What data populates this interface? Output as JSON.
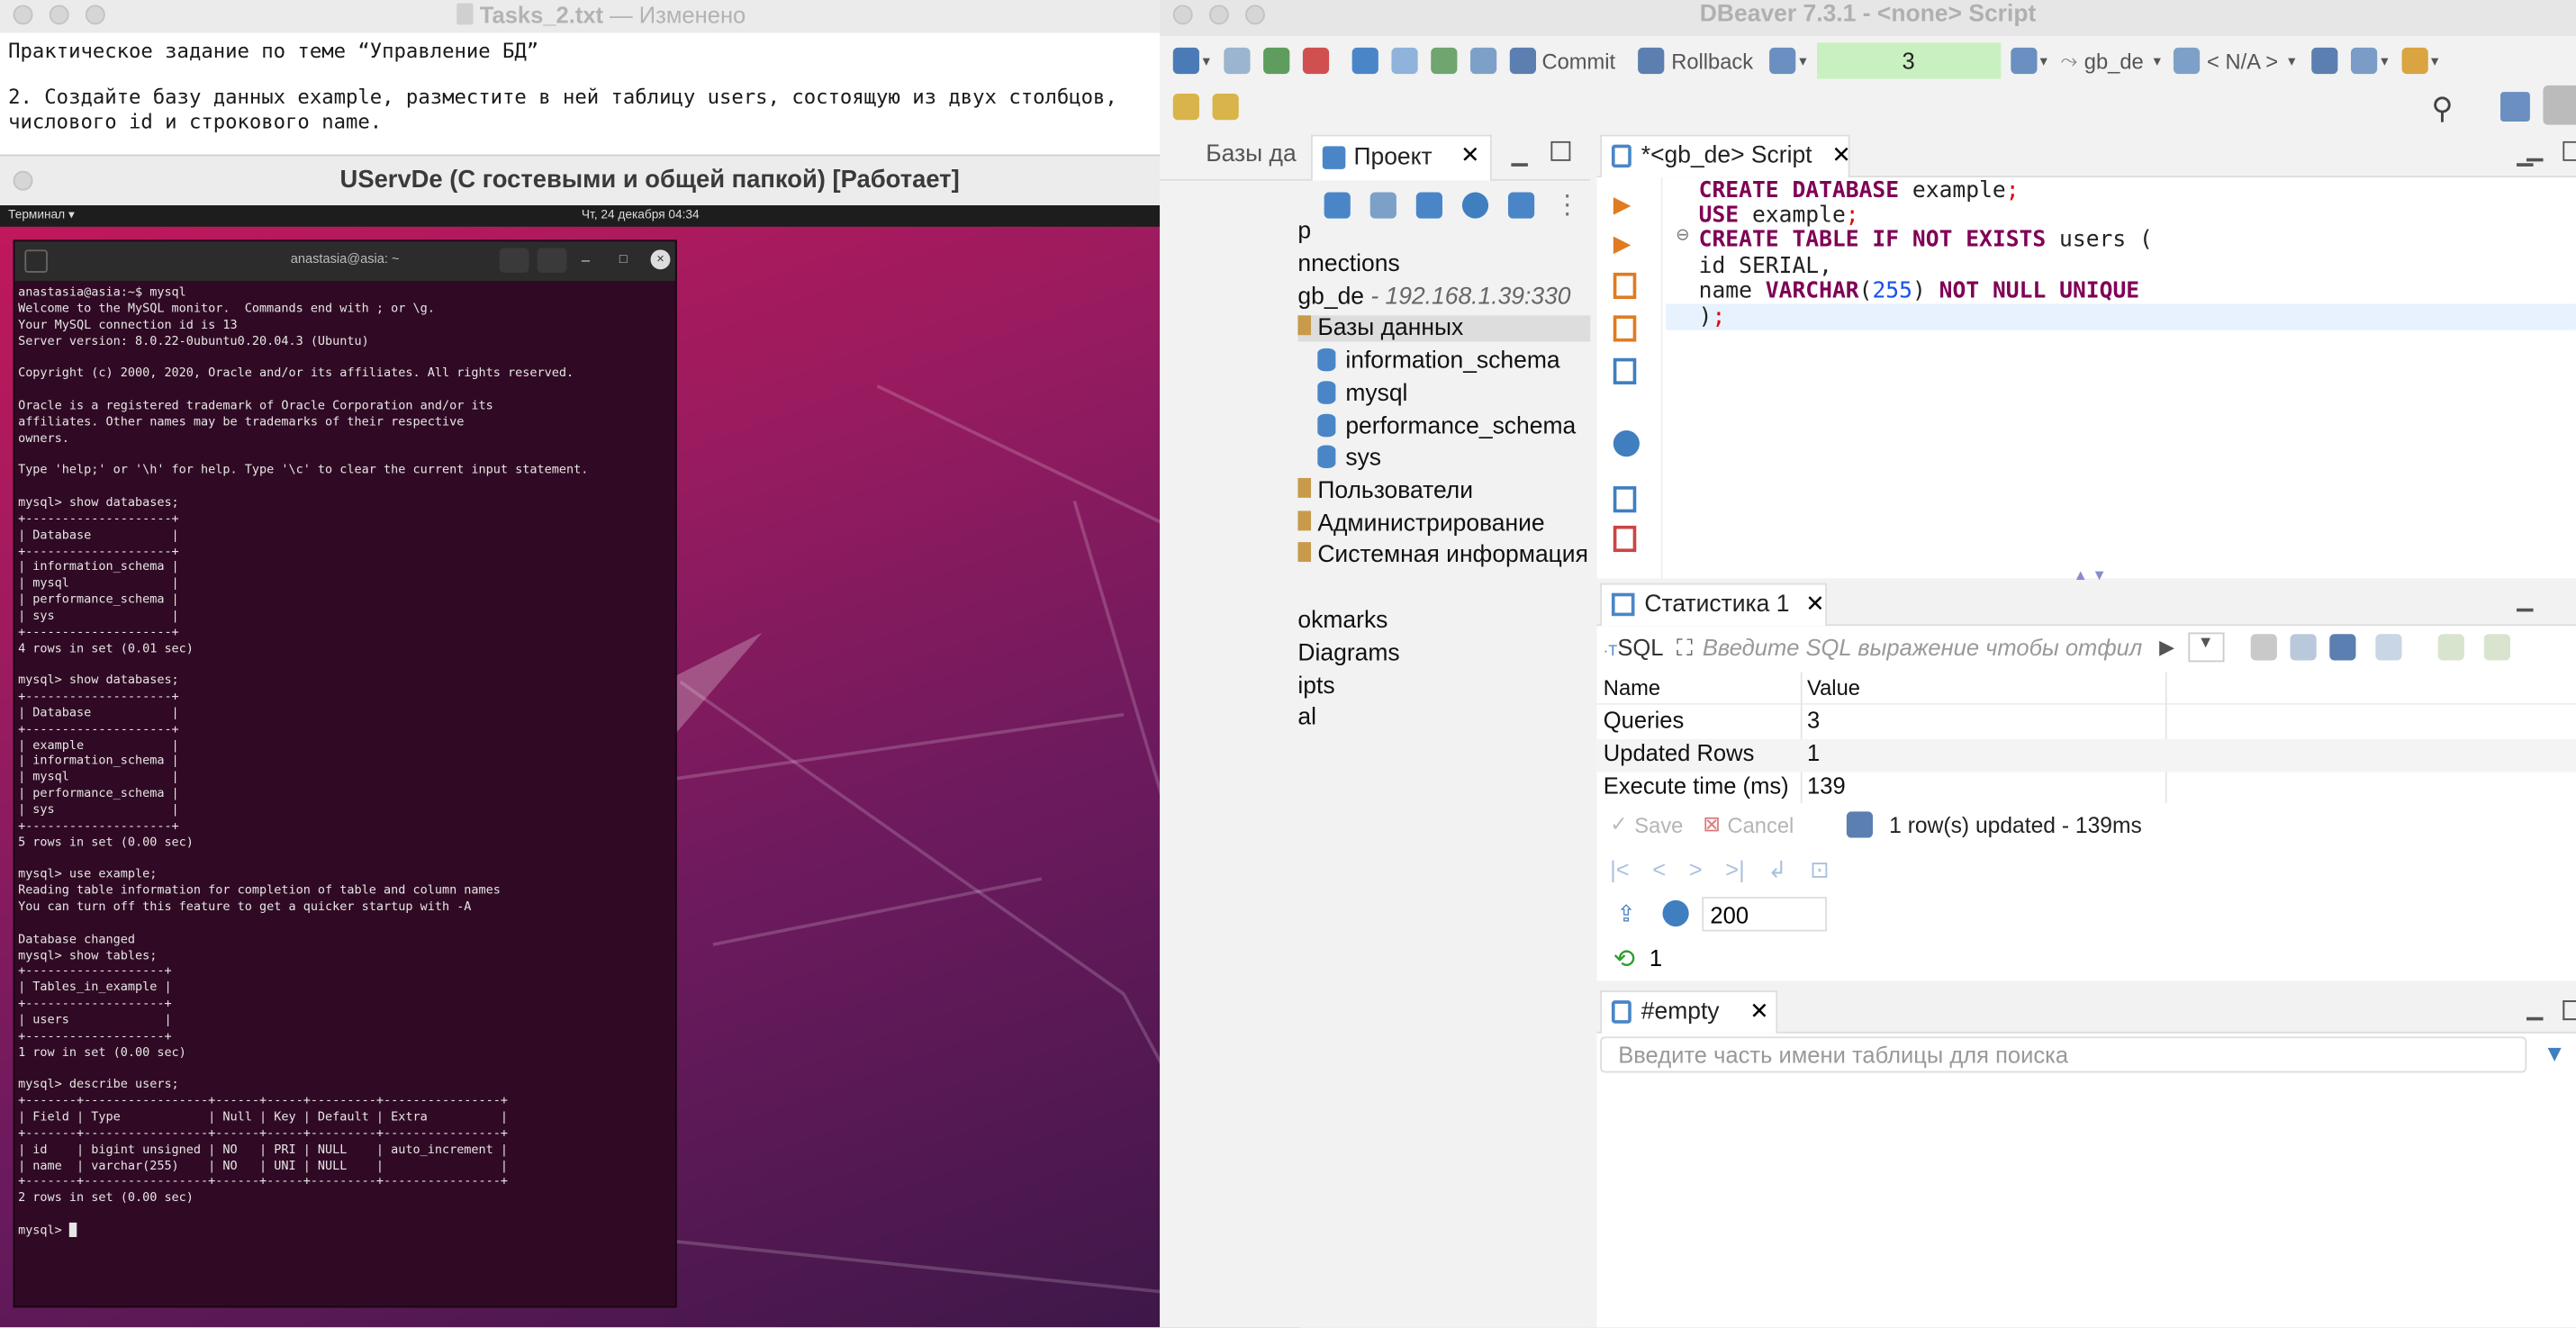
{
  "text_editor": {
    "title": "Tasks_2.txt",
    "title_suffix": "— Изменено",
    "lines": [
      "Практическое задание по теме “Управление БД”",
      "",
      "2. Создайте базу данных example, разместите в ней таблицу users, состоящую из двух столбцов,",
      "числового id и строкового name."
    ]
  },
  "vm": {
    "title": "UServDe (С гостевыми и общей папкой) [Работает]",
    "topbar_app": "Терминал ▾",
    "topbar_clock": "Чт, 24 декабря  04:34",
    "terminal_title": "anastasia@asia: ~",
    "terminal_text": "anastasia@asia:~$ mysql\nWelcome to the MySQL monitor.  Commands end with ; or \\g.\nYour MySQL connection id is 13\nServer version: 8.0.22-0ubuntu0.20.04.3 (Ubuntu)\n\nCopyright (c) 2000, 2020, Oracle and/or its affiliates. All rights reserved.\n\nOracle is a registered trademark of Oracle Corporation and/or its\naffiliates. Other names may be trademarks of their respective\nowners.\n\nType 'help;' or '\\h' for help. Type '\\c' to clear the current input statement.\n\nmysql> show databases;\n+--------------------+\n| Database           |\n+--------------------+\n| information_schema |\n| mysql              |\n| performance_schema |\n| sys                |\n+--------------------+\n4 rows in set (0.01 sec)\n\nmysql> show databases;\n+--------------------+\n| Database           |\n+--------------------+\n| example            |\n| information_schema |\n| mysql              |\n| performance_schema |\n| sys                |\n+--------------------+\n5 rows in set (0.00 sec)\n\nmysql> use example;\nReading table information for completion of table and column names\nYou can turn off this feature to get a quicker startup with -A\n\nDatabase changed\nmysql> show tables;\n+-------------------+\n| Tables_in_example |\n+-------------------+\n| users             |\n+-------------------+\n1 row in set (0.00 sec)\n\nmysql> describe users;\n+-------+-----------------+------+-----+---------+----------------+\n| Field | Type            | Null | Key | Default | Extra          |\n+-------+-----------------+------+-----+---------+----------------+\n| id    | bigint unsigned | NO   | PRI | NULL    | auto_increment |\n| name  | varchar(255)    | NO   | UNI | NULL    |                |\n+-------+-----------------+------+-----+---------+----------------+\n2 rows in set (0.00 sec)\n\nmysql> █"
  },
  "dbeaver": {
    "title": "DBeaver 7.3.1 - <none> Script",
    "toolbar": {
      "commit": "Commit",
      "rollback": "Rollback",
      "tx_count": "3",
      "datasource": "gb_de",
      "schema": "< N/A >"
    },
    "left_tabs": {
      "db_nav": "Базы да",
      "project": "Проект"
    },
    "tree": [
      "p",
      "nnections",
      "gb_de",
      "Базы данных",
      "information_schema",
      "mysql",
      "performance_schema",
      "sys",
      "Пользователи",
      "Администрирование",
      "Системная информация",
      "okmarks",
      "Diagrams",
      "ipts",
      "al"
    ],
    "connection_host": " - 192.168.1.39:330",
    "editor_tab": "*<gb_de> Script",
    "sql_lines": {
      "l1_kw": "CREATE DATABASE",
      "l1_rest": " example",
      "l2_kw": "USE",
      "l2_rest": " example",
      "l3_kw": "CREATE TABLE IF NOT EXISTS",
      "l3_rest": " users (",
      "l4": "id SERIAL,",
      "l5_a": "name ",
      "l5_kw": "VARCHAR",
      "l5_num": "255",
      "l5_kw2": "NOT NULL UNIQUE",
      "l6": ")"
    },
    "stats_tab": "Статистика 1",
    "filter_placeholder": "Введите SQL выражение чтобы отфил",
    "stats_headers": [
      "Name",
      "Value"
    ],
    "stats_rows": [
      [
        "Queries",
        "3"
      ],
      [
        "Updated Rows",
        "1"
      ],
      [
        "Execute time (ms)",
        "139"
      ]
    ],
    "save": "Save",
    "cancel": "Cancel",
    "status_msg": "1 row(s) updated - 139ms",
    "fetch_size": "200",
    "refresh_count": "1",
    "empty_tab": "#empty",
    "table_search_placeholder": "Введите часть имени таблицы для поиска"
  }
}
